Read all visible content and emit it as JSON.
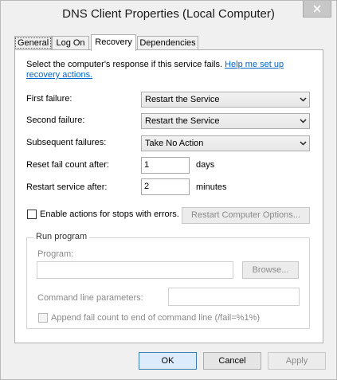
{
  "window": {
    "title": "DNS Client Properties (Local Computer)"
  },
  "tabs": [
    {
      "label": "General"
    },
    {
      "label": "Log On"
    },
    {
      "label": "Recovery"
    },
    {
      "label": "Dependencies"
    }
  ],
  "recovery": {
    "intro_text": "Select the computer's response if this service fails.",
    "help_link": "Help me set up recovery actions.",
    "first_failure": {
      "label": "First failure:",
      "value": "Restart the Service"
    },
    "second_failure": {
      "label": "Second failure:",
      "value": "Restart the Service"
    },
    "subsequent_failures": {
      "label": "Subsequent failures:",
      "value": "Take No Action"
    },
    "reset_fail_count": {
      "label": "Reset fail count after:",
      "value": "1",
      "unit": "days"
    },
    "restart_service": {
      "label": "Restart service after:",
      "value": "2",
      "unit": "minutes"
    },
    "enable_actions": {
      "label": "Enable actions for stops with errors.",
      "checked": false
    },
    "restart_computer_options": "Restart Computer Options...",
    "run_program": {
      "group_title": "Run program",
      "program_label": "Program:",
      "program_value": "",
      "browse_label": "Browse...",
      "command_line_label": "Command line parameters:",
      "command_line_value": "",
      "append_fail_count_label": "Append fail count to end of command line (/fail=%1%)",
      "append_fail_count_checked": false
    }
  },
  "buttons": {
    "ok": "OK",
    "cancel": "Cancel",
    "apply": "Apply"
  }
}
